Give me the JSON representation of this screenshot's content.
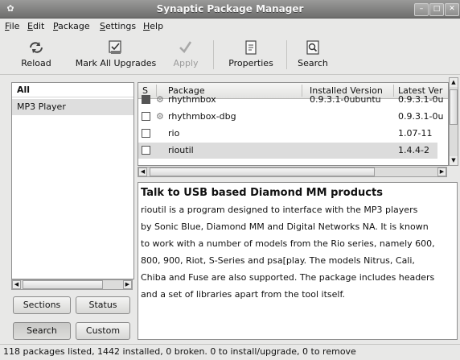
{
  "window": {
    "title": "Synaptic Package Manager",
    "controls": [
      "–",
      "□",
      "✕"
    ]
  },
  "menu": [
    "File",
    "Edit",
    "Package",
    "Settings",
    "Help"
  ],
  "toolbar": {
    "reload": "Reload",
    "mark_all": "Mark All Upgrades",
    "apply": "Apply",
    "properties": "Properties",
    "search": "Search"
  },
  "filters": {
    "header": "All",
    "items": [
      "MP3 Player"
    ]
  },
  "left_buttons": {
    "sections": "Sections",
    "status": "Status",
    "search": "Search",
    "custom": "Custom"
  },
  "table": {
    "columns": [
      "S",
      "Package",
      "Installed Version",
      "Latest Ver"
    ],
    "rows": [
      {
        "package": "rhythmbox",
        "installed": "0.9.3.1-0ubuntu",
        "latest": "0.9.3.1-0u"
      },
      {
        "package": "rhythmbox-dbg",
        "installed": "",
        "latest": "0.9.3.1-0u"
      },
      {
        "package": "rio",
        "installed": "",
        "latest": "1.07-11"
      },
      {
        "package": "rioutil",
        "installed": "",
        "latest": "1.4.4-2"
      }
    ]
  },
  "description": {
    "title": "Talk to USB based Diamond MM products",
    "lines": [
      "rioutil is a program designed to interface with the MP3 players",
      "by Sonic Blue, Diamond MM and Digital Networks NA.  It is known",
      "to work with a number of models from the Rio series, namely 600,",
      "800, 900, Riot, S-Series and psa[play.  The models Nitrus, Cali,",
      "Chiba and Fuse are also supported.  The package includes headers",
      "and a set of libraries apart from the tool itself."
    ]
  },
  "status": "118 packages listed, 1442 installed, 0 broken. 0 to install/upgrade, 0 to remove"
}
